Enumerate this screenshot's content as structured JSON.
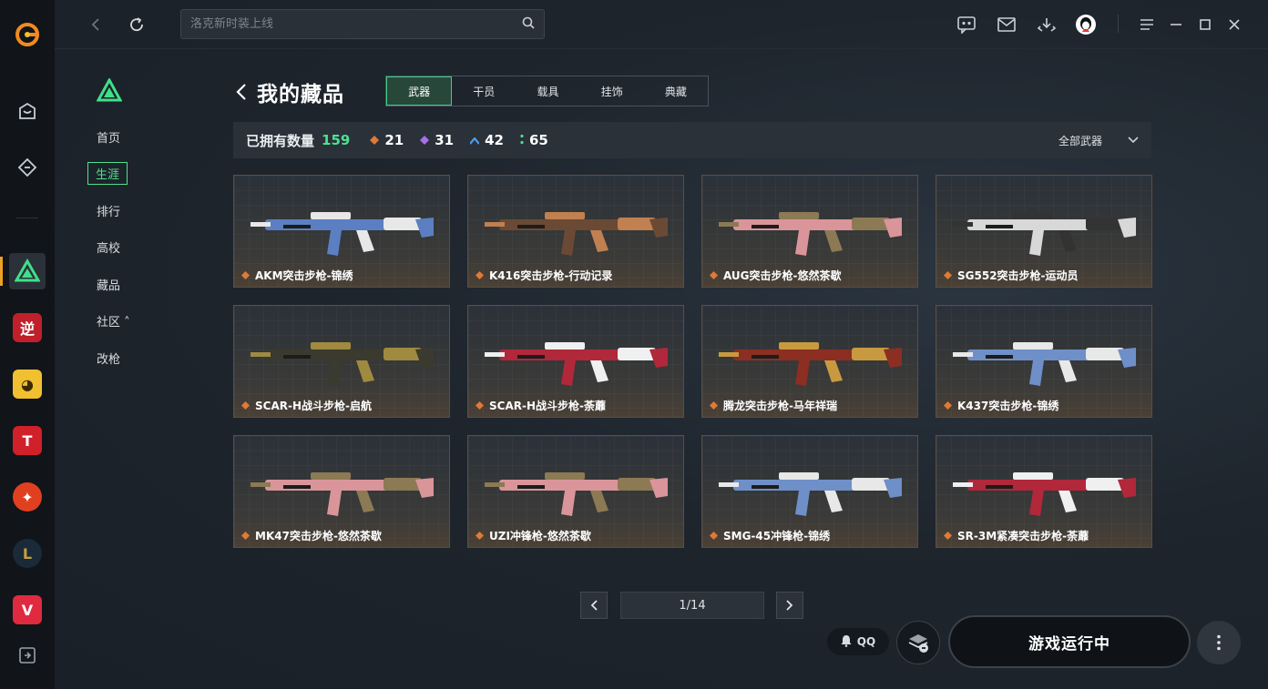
{
  "search": {
    "placeholder": "洛克新时装上线"
  },
  "subnav": {
    "items": [
      {
        "label": "首页"
      },
      {
        "label": "生涯"
      },
      {
        "label": "排行"
      },
      {
        "label": "高校"
      },
      {
        "label": "藏品"
      },
      {
        "label": "社区 ˄"
      },
      {
        "label": "改枪"
      }
    ]
  },
  "header": {
    "title": "我的藏品"
  },
  "tabs": [
    {
      "label": "武器"
    },
    {
      "label": "干员"
    },
    {
      "label": "载具"
    },
    {
      "label": "挂饰"
    },
    {
      "label": "典藏"
    }
  ],
  "summary": {
    "owned_label": "已拥有数量",
    "owned_count": "159",
    "rarity": [
      {
        "count": "21",
        "color": "#e07a36"
      },
      {
        "count": "31",
        "color": "#a770e8"
      },
      {
        "count": "42",
        "color": "#4f9de8"
      },
      {
        "count": "65",
        "color": "#4fe08f"
      }
    ],
    "filter": "全部武器"
  },
  "cards": [
    {
      "name": "AKM突击步枪-锦绣",
      "color": "#5b7fc2",
      "accent": "#e8e8e8"
    },
    {
      "name": "K416突击步枪-行动记录",
      "color": "#6b4a35",
      "accent": "#c08050"
    },
    {
      "name": "AUG突击步枪-悠然茶歇",
      "color": "#d9959a",
      "accent": "#8c7a55"
    },
    {
      "name": "SG552突击步枪-运动员",
      "color": "#d8d8d8",
      "accent": "#333333"
    },
    {
      "name": "SCAR-H战斗步枪-启航",
      "color": "#3b3a2e",
      "accent": "#a08a40"
    },
    {
      "name": "SCAR-H战斗步枪-荼蘼",
      "color": "#b0283a",
      "accent": "#f0f0f0"
    },
    {
      "name": "腾龙突击步枪-马年祥瑞",
      "color": "#8c2e22",
      "accent": "#c89a40"
    },
    {
      "name": "K437突击步枪-锦绣",
      "color": "#6f8fc8",
      "accent": "#e8e8e8"
    },
    {
      "name": "MK47突击步枪-悠然茶歇",
      "color": "#d9959a",
      "accent": "#8c7a55"
    },
    {
      "name": "UZI冲锋枪-悠然茶歇",
      "color": "#d9959a",
      "accent": "#8c7a55"
    },
    {
      "name": "SMG-45冲锋枪-锦绣",
      "color": "#6f8fc8",
      "accent": "#e8e8e8"
    },
    {
      "name": "SR-3M紧凑突击步枪-荼蘼",
      "color": "#b0283a",
      "accent": "#f0f0f0"
    }
  ],
  "pager": {
    "page": "1/14"
  },
  "bottom": {
    "qq_label": "QQ",
    "launch_label": "游戏运行中"
  }
}
